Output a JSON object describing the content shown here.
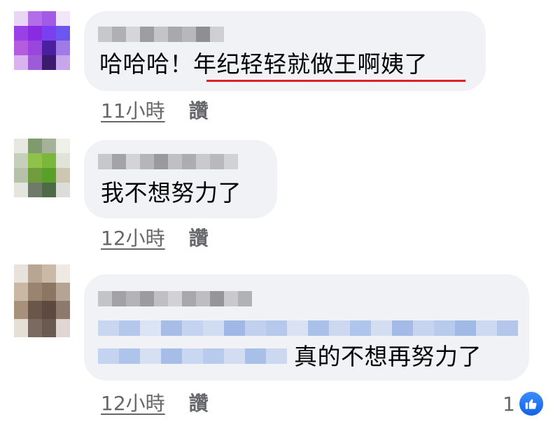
{
  "comments": [
    {
      "text_plain": "哈哈哈！",
      "text_highlight": "年纪轻轻就做王啊姨了",
      "time": "11小時",
      "like_label": "讚"
    },
    {
      "text": "我不想努力了",
      "time": "12小時",
      "like_label": "讚"
    },
    {
      "text": "真的不想再努力了",
      "time": "12小時",
      "like_label": "讚",
      "reaction_count": "1",
      "reaction_icon": "thumbs-up-icon"
    }
  ],
  "colors": {
    "bubble": "#f0f2f5",
    "underline": "#e01f25",
    "meta_text": "#65676b",
    "like_blue": "#1877f2"
  }
}
